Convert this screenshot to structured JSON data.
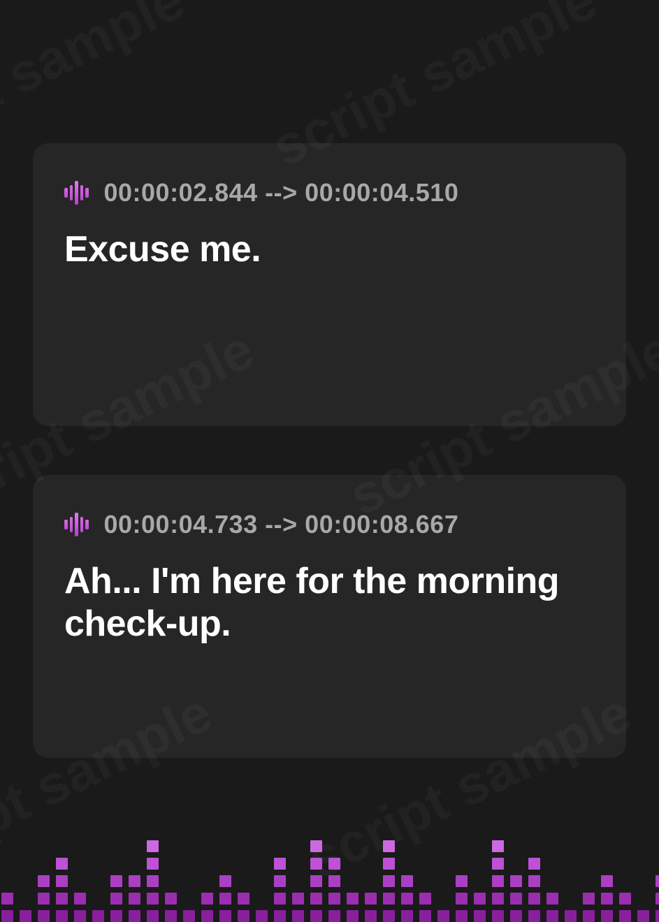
{
  "watermark_text": "script sample",
  "captions": [
    {
      "timestamp": "00:00:02.844 --> 00:00:04.510",
      "text": "Excuse me."
    },
    {
      "timestamp": "00:00:04.733 --> 00:00:08.667",
      "text": "Ah... I'm here for the morning check-up."
    }
  ],
  "colors": {
    "background": "#1a1a1a",
    "card_bg": "rgba(255,255,255,0.055)",
    "timestamp_text": "#a8a8a8",
    "subtitle_text": "#ffffff",
    "accent_start": "#d66be0",
    "accent_end": "#b93ed4"
  },
  "equalizer_heights": [
    2,
    1,
    3,
    4,
    2,
    1,
    3,
    3,
    5,
    2,
    1,
    2,
    3,
    2,
    1,
    4,
    2,
    5,
    4,
    2,
    2,
    5,
    3,
    2,
    1,
    3,
    2,
    5,
    3,
    4,
    2,
    1,
    2,
    3,
    2,
    1,
    3
  ]
}
